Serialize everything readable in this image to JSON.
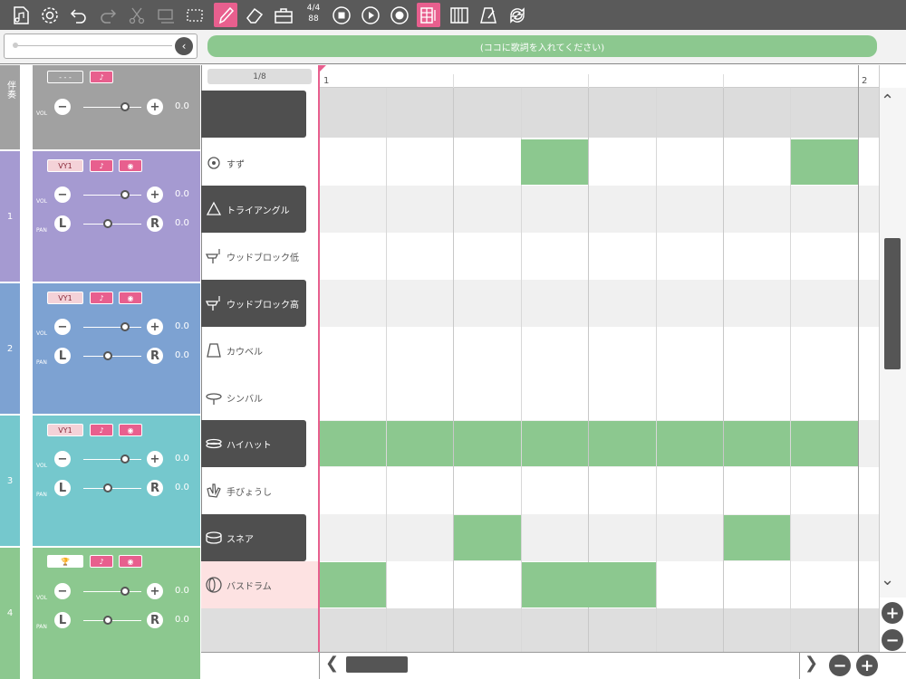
{
  "toolbar": {
    "time_signature_top": "4/4",
    "time_signature_bottom": "88"
  },
  "lyrics": {
    "placeholder": "(ココに歌詞を入れてください)"
  },
  "tracks": [
    {
      "label": "伴奏",
      "chip1": "- - -",
      "vol_value": "0.0",
      "color": "#a1a1a1"
    },
    {
      "label": "1",
      "chip1": "VY1",
      "vol_value": "0.0",
      "pan_value": "0.0",
      "color": "#a59ad1"
    },
    {
      "label": "2",
      "chip1": "VY1",
      "vol_value": "0.0",
      "pan_value": "0.0",
      "color": "#7da2d2"
    },
    {
      "label": "3",
      "chip1": "VY1",
      "vol_value": "0.0",
      "pan_value": "0.0",
      "color": "#75c8cd"
    },
    {
      "label": "4",
      "vol_value": "0.0",
      "pan_value": "0.0",
      "color": "#8cc88f"
    }
  ],
  "control_labels": {
    "vol": "VOL",
    "pan": "PAN",
    "left": "L",
    "right": "R",
    "minus": "−",
    "plus": "+"
  },
  "instrument_header": "1/8",
  "instruments": [
    {
      "name": "",
      "icon": ""
    },
    {
      "name": "すず",
      "icon": "bell-icon"
    },
    {
      "name": "トライアングル",
      "icon": "triangle-icon"
    },
    {
      "name": "ウッドブロック低",
      "icon": "woodblock-low-icon"
    },
    {
      "name": "ウッドブロック高",
      "icon": "woodblock-high-icon"
    },
    {
      "name": "カウベル",
      "icon": "cowbell-icon"
    },
    {
      "name": "シンバル",
      "icon": "cymbal-icon"
    },
    {
      "name": "ハイハット",
      "icon": "hihat-icon"
    },
    {
      "name": "手びょうし",
      "icon": "clap-icon"
    },
    {
      "name": "スネア",
      "icon": "snare-icon"
    },
    {
      "name": "バスドラム",
      "icon": "bassdrum-icon"
    }
  ],
  "ruler": {
    "measure1": "1",
    "measure2": "2"
  },
  "colors": {
    "accent": "#e85f8e",
    "note": "#8cc88f",
    "dark": "#4f4f4f"
  }
}
